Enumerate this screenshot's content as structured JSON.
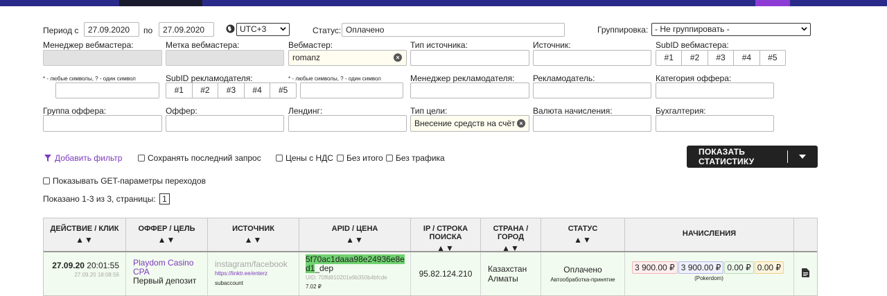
{
  "filters": {
    "period_label": "Период с",
    "date_from": "27.09.2020",
    "date_sep": "по",
    "date_to": "27.09.2020",
    "timezone": "UTC+3",
    "status_label": "Статус:",
    "status_value": "Оплачено",
    "grouping_label": "Группировка:",
    "grouping_value": "- Не группировать -",
    "webmaster_manager_label": "Менеджер вебмастера:",
    "webmaster_mark_label": "Метка вебмастера:",
    "webmaster_label": "Вебмастер:",
    "webmaster_value": "romanz",
    "source_type_label": "Тип источника:",
    "source_label": "Источник:",
    "subid_webmaster_label": "SubID вебмастера:",
    "subid_items": [
      "#1",
      "#2",
      "#3",
      "#4",
      "#5"
    ],
    "hint_text": "* - любые символы, ? - один символ",
    "subid_advertiser_label": "SubID рекламодателя:",
    "advertiser_manager_label": "Менеджер рекламодателя:",
    "advertiser_label": "Рекламодатель:",
    "offer_category_label": "Категория оффера:",
    "offer_group_label": "Группа оффера:",
    "offer_label": "Оффер:",
    "landing_label": "Лендинг:",
    "goal_type_label": "Тип цели:",
    "goal_type_value": "Внесение средств на счёт",
    "currency_label": "Валюта начисления:",
    "accounting_label": "Бухгалтерия:"
  },
  "controls": {
    "add_filter": "Добавить фильтр",
    "save_last_query": "Сохранять последний запрос",
    "prices_with_vat": "Цены с НДС",
    "no_total": "Без итого",
    "no_traffic": "Без трафика",
    "show_get_params": "Показывать GET-параметры переходов",
    "show_stats_button": "ПОКАЗАТЬ СТАТИСТИКУ",
    "pager_text": "Показано 1-3 из 3, страницы:",
    "pager_page": "1"
  },
  "table": {
    "headers": [
      "ДЕЙСТВИЕ / КЛИК",
      "ОФФЕР / ЦЕЛЬ",
      "ИСТОЧНИК",
      "APID / ЦЕНА",
      "IP / СТРОКА ПОИСКА",
      "СТРАНА / ГОРОД",
      "СТАТУС",
      "НАЧИСЛЕНИЯ"
    ],
    "sort_glyph": "▲▼",
    "row": {
      "action_date": "27.09.20",
      "action_time": "20:01:55",
      "click_date": "27.09.20",
      "click_time": "18:08:56",
      "offer_name": "Playdom Casino CPA",
      "goal": "Первый депозит",
      "source_name": "instagram/facebook",
      "source_url": "https://linktr.ee/enterz",
      "source_sub": "subaccount",
      "apid_highlight": "5f70ac1daaa98e24936e8ed1",
      "apid_suffix": "_dep",
      "uid": "UID: 70ffd810201e9b350b4bfcde",
      "price": "7.02 ₽",
      "ip": "95.82.124.210",
      "country": "Казахстан",
      "city": "Алматы",
      "status": "Оплачено",
      "status_note": "Автообработка-принятие",
      "money": [
        "3 900.00 ₽",
        "3 900.00 ₽",
        "0.00 ₽",
        "0.00 ₽"
      ],
      "accounting_name": "(Pokerdom)"
    }
  },
  "icons": {
    "globe": "globe-icon",
    "filter": "filter-icon",
    "document": "document-icon"
  },
  "colors": {
    "accent_purple": "#7c3ac0",
    "button_dark": "#222222",
    "row_bg": "#f2fbef",
    "apid_highlight": "#6fd26f"
  }
}
